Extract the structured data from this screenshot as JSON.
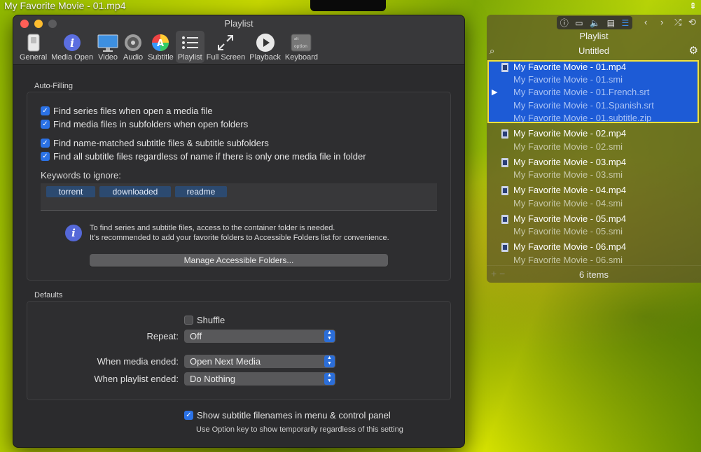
{
  "video": {
    "title": "My Favorite Movie - 01.mp4",
    "pin_icon": "pin-icon"
  },
  "prefs": {
    "window_title": "Playlist",
    "toolbar": [
      {
        "label": "General",
        "icon": "toggle-icon"
      },
      {
        "label": "Media Open",
        "icon": "info-icon"
      },
      {
        "label": "Video",
        "icon": "monitor-icon"
      },
      {
        "label": "Audio",
        "icon": "speaker-icon"
      },
      {
        "label": "Subtitle",
        "icon": "color-wheel-icon"
      },
      {
        "label": "Playlist",
        "icon": "list-icon"
      },
      {
        "label": "Full Screen",
        "icon": "expand-icon"
      },
      {
        "label": "Playback",
        "icon": "play-circle-icon"
      },
      {
        "label": "Keyboard",
        "icon": "key-icon"
      }
    ],
    "active_tab": "Playlist",
    "auto_filling": {
      "title": "Auto-Filling",
      "checks": [
        {
          "label": "Find series files when open a media file",
          "checked": true
        },
        {
          "label": "Find media files in subfolders when open folders",
          "checked": true
        },
        {
          "label": "Find name-matched subtitle files & subtitle subfolders",
          "checked": true
        },
        {
          "label": "Find all subtitle files regardless of name if there is only one media file in folder",
          "checked": true
        }
      ],
      "keywords_label": "Keywords to ignore:",
      "keywords": [
        "torrent",
        "downloaded",
        "readme"
      ],
      "info_line1": "To find series and subtitle files, access to the container folder is needed.",
      "info_line2": "It's recommended to add your favorite folders to Accessible Folders list for convenience.",
      "manage_button": "Manage Accessible Folders..."
    },
    "defaults": {
      "title": "Defaults",
      "shuffle_label": "Shuffle",
      "shuffle_checked": false,
      "repeat_label": "Repeat:",
      "repeat_value": "Off",
      "media_ended_label": "When media ended:",
      "media_ended_value": "Open Next Media",
      "playlist_ended_label": "When playlist ended:",
      "playlist_ended_value": "Do Nothing"
    },
    "show_subtitle_label": "Show subtitle filenames in menu & control panel",
    "show_subtitle_checked": true,
    "option_note": "Use Option key to show temporarily regardless of this setting"
  },
  "playlist": {
    "title": "Playlist",
    "name": "Untitled",
    "items": [
      {
        "main": "My Favorite Movie - 01.mp4",
        "subs": [
          "My Favorite Movie - 01.smi",
          "My Favorite Movie - 01.French.srt",
          "My Favorite Movie - 01.Spanish.srt",
          "My Favorite Movie - 01.subtitle.zip"
        ]
      },
      {
        "main": "My Favorite Movie - 02.mp4",
        "subs": [
          "My Favorite Movie - 02.smi"
        ]
      },
      {
        "main": "My Favorite Movie - 03.mp4",
        "subs": [
          "My Favorite Movie - 03.smi"
        ]
      },
      {
        "main": "My Favorite Movie - 04.mp4",
        "subs": [
          "My Favorite Movie - 04.smi"
        ]
      },
      {
        "main": "My Favorite Movie - 05.mp4",
        "subs": [
          "My Favorite Movie - 05.smi"
        ]
      },
      {
        "main": "My Favorite Movie - 06.mp4",
        "subs": [
          "My Favorite Movie - 06.smi"
        ]
      }
    ],
    "count": "6 items"
  },
  "colors": {
    "accent": "#2b72e6",
    "selection": "#1d5bd6",
    "selection_border": "#f3e23a"
  }
}
